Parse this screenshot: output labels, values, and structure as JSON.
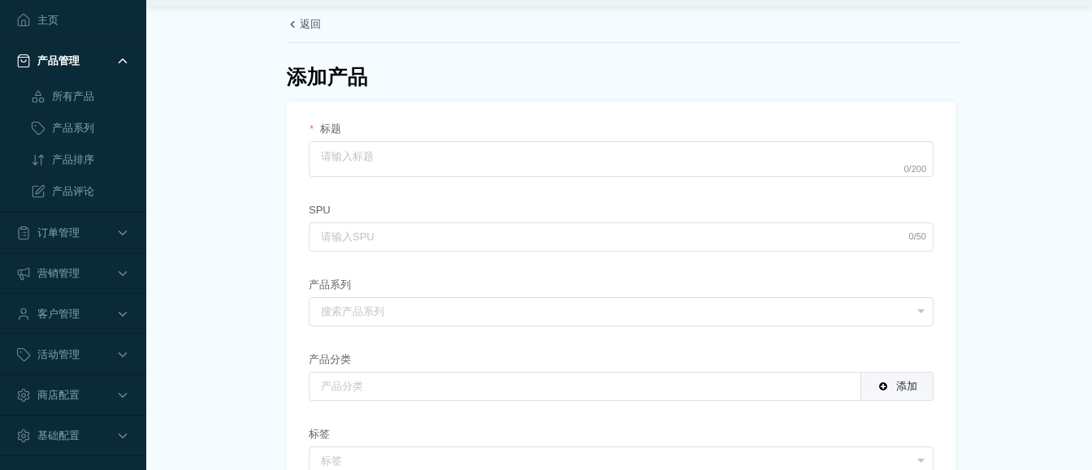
{
  "sidebar": {
    "items": [
      {
        "label": "主页",
        "selected": false
      },
      {
        "label": "产品管理",
        "selected": true,
        "expanded": true,
        "children": [
          {
            "label": "所有产品",
            "selected": false
          },
          {
            "label": "产品系列",
            "selected": false
          },
          {
            "label": "产品排序",
            "selected": false
          },
          {
            "label": "产品评论",
            "selected": false
          }
        ]
      },
      {
        "label": "订单管理",
        "selected": false,
        "expanded": false
      },
      {
        "label": "营销管理",
        "selected": false,
        "expanded": false
      },
      {
        "label": "客户管理",
        "selected": false,
        "expanded": false
      },
      {
        "label": "活动管理",
        "selected": false,
        "expanded": false
      },
      {
        "label": "商店配置",
        "selected": false,
        "expanded": false
      },
      {
        "label": "基础配置",
        "selected": false,
        "expanded": false
      }
    ]
  },
  "back": "返回",
  "title": "添加产品",
  "form": {
    "fields": [
      {
        "kind": "textarea",
        "label": "标题",
        "required_mark": "*",
        "placeholder": "请输入标题",
        "counter": "0/200"
      },
      {
        "kind": "input",
        "label": "SPU",
        "placeholder": "请输入SPU",
        "counter": "0/50"
      },
      {
        "kind": "select",
        "label": "产品系列",
        "placeholder": "搜索产品系列"
      },
      {
        "kind": "input-button",
        "label": "产品分类",
        "placeholder": "产品分类",
        "button": "添加"
      },
      {
        "kind": "select",
        "label": "标签",
        "placeholder": "标签"
      }
    ]
  }
}
